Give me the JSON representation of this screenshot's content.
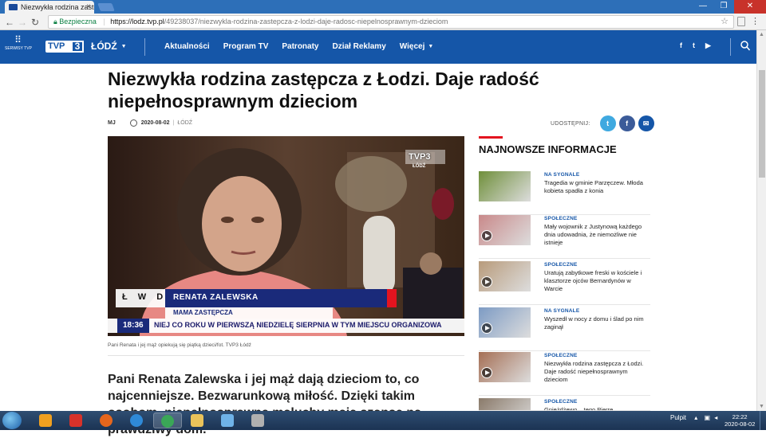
{
  "browser": {
    "tab_title": "Niezwykła rodzina zastęp",
    "tab_close": "×",
    "secure_label": "Bezpieczna",
    "url_host": "https://lodz.tvp.pl",
    "url_path": "/49238037/niezwykla-rodzina-zastepcza-z-lodzi-daje-radosc-niepelnosprawnym-dzieciom",
    "window_controls": [
      "—",
      "❐",
      "✕"
    ]
  },
  "header": {
    "services_label": "SERWISY TVP",
    "logo_text": "TVP",
    "logo_number": "3",
    "city": "ŁÓDŹ",
    "nav": [
      {
        "label": "Aktualności"
      },
      {
        "label": "Program TV"
      },
      {
        "label": "Patronaty"
      },
      {
        "label": "Dział Reklamy"
      },
      {
        "label": "Więcej"
      }
    ],
    "social": [
      "f",
      "t",
      "▶"
    ]
  },
  "article": {
    "title": "Niezwykła rodzina zastępcza z Łodzi. Daje radość niepełnosprawnym dzieciom",
    "author": "MJ",
    "date": "2020-08-02",
    "category": "ŁÓDŹ",
    "share_label": "UDOSTĘPNIJ:",
    "share_icons": [
      "t",
      "f",
      "✉"
    ],
    "caption": "Pani Renata i jej mąż opiekują się piątką dzieci/fot. TVP3 Łódź",
    "lead": "Pani Renata Zalewska i jej mąż dają dzieciom to, co najcenniejsze. Bezwarunkową miłość. Dzięki takim osobom, niepełnosprawne maluchy mają szansę na prawdziwy dom."
  },
  "video": {
    "watermark_top": "TVP3",
    "watermark_bottom": "ŁÓDŹ",
    "station_letters": "Ł W D",
    "name": "RENATA ZALEWSKA",
    "role": "MAMA ZASTĘPCZA",
    "time": "18:36",
    "ticker": "NIEJ CO ROKU W PIERWSZĄ NIEDZIELĘ SIERPNIA W TYM MIEJSCU ORGANIZOWA"
  },
  "sidebar": {
    "title": "NAJNOWSZE INFORMACJE",
    "items": [
      {
        "category": "NA SYGNALE",
        "headline": "Tragedia w gminie Parzęczew. Młoda kobieta spadła z konia",
        "thumb": "#6f8f3a",
        "video": false
      },
      {
        "category": "SPOŁECZNE",
        "headline": "Mały wojownik z Justynową każdego dnia udowadnia, że niemożliwe nie istnieje",
        "thumb": "#c9898a",
        "video": true
      },
      {
        "category": "SPOŁECZNE",
        "headline": "Uratują zabytkowe freski w kościele i klasztorze ojców Bernardynów w Warcie",
        "thumb": "#b89b7b",
        "video": true
      },
      {
        "category": "NA SYGNALE",
        "headline": "Wyszedł w nocy z domu i ślad po nim zaginął",
        "thumb": "#7d9bc4",
        "video": true
      },
      {
        "category": "SPOŁECZNE",
        "headline": "Niezwykła rodzina zastępcza z Łodzi. Daje radość niepełnosprawnym dzieciom",
        "thumb": "#a56f55",
        "video": true
      },
      {
        "category": "SPOŁECZNE",
        "headline": "Gnieżdżewo – tego Pierre...",
        "thumb": "#8a7a6a",
        "video": false
      }
    ]
  },
  "taskbar": {
    "tray_label": "Pulpit",
    "time": "22:22",
    "date": "2020-08-02",
    "apps": [
      {
        "name": "media-player",
        "color": "#f0a020"
      },
      {
        "name": "puzzle-app",
        "color": "#d8322a"
      },
      {
        "name": "firefox",
        "color": "#e5661d"
      },
      {
        "name": "internet-explorer",
        "color": "#2f8ad8"
      },
      {
        "name": "chrome",
        "color": "#3aa757"
      },
      {
        "name": "explorer",
        "color": "#e9c25a"
      },
      {
        "name": "chat-app",
        "color": "#6fb3e8"
      },
      {
        "name": "tools-app",
        "color": "#b0b0b0"
      }
    ]
  },
  "colors": {
    "brand": "#1556a8",
    "accent": "#e3141f"
  }
}
